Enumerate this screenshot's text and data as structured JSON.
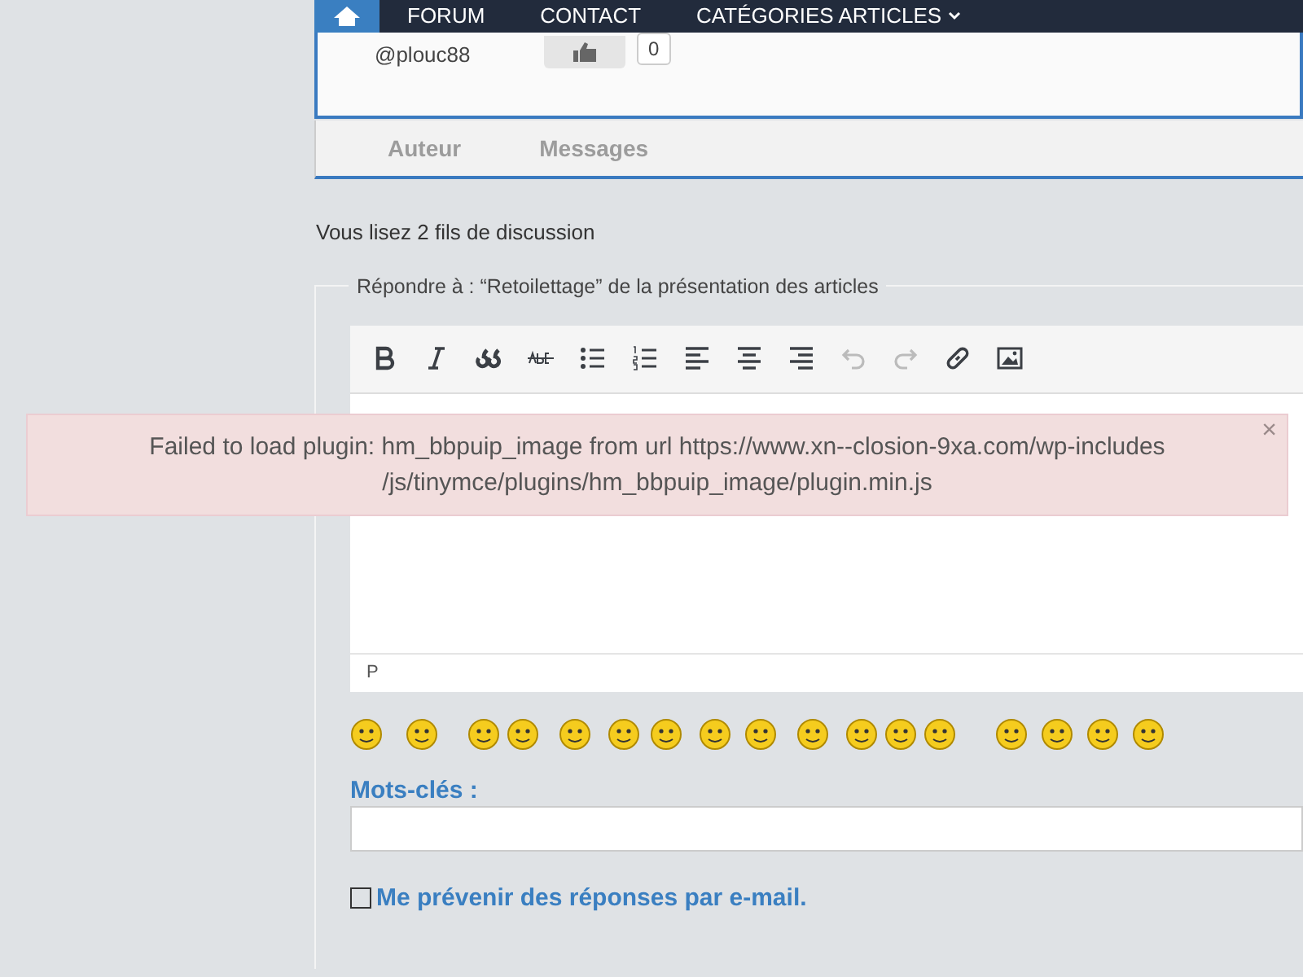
{
  "nav": {
    "items": [
      {
        "label": "FORUM",
        "dropdown": false
      },
      {
        "label": "CONTACT",
        "dropdown": false
      },
      {
        "label": "CATÉGORIES ARTICLES",
        "dropdown": true
      }
    ]
  },
  "post": {
    "author": "@plouc88",
    "likes": "0"
  },
  "table": {
    "columns": [
      "Auteur",
      "Messages"
    ]
  },
  "thread_count": "Vous lisez 2 fils de discussion",
  "reply_form": {
    "legend": "Répondre à : “Retoilettage” de la présentation des articles",
    "toolbar": [
      {
        "kind": "bold",
        "disabled": false
      },
      {
        "kind": "italic",
        "disabled": false
      },
      {
        "kind": "quote",
        "disabled": false
      },
      {
        "kind": "strike",
        "disabled": false
      },
      {
        "kind": "bullets",
        "disabled": false
      },
      {
        "kind": "numbers",
        "disabled": false
      },
      {
        "kind": "align-left",
        "disabled": false
      },
      {
        "kind": "align-center",
        "disabled": false
      },
      {
        "kind": "align-right",
        "disabled": false
      },
      {
        "kind": "undo",
        "disabled": true
      },
      {
        "kind": "redo",
        "disabled": true
      },
      {
        "kind": "link",
        "disabled": false
      },
      {
        "kind": "image",
        "disabled": false
      }
    ],
    "path": "P",
    "error": {
      "message": "Failed to load plugin: hm_bbpuip_image from url https://www.xn--closion-9xa.com/wp-includes /js/tinymce/plugins/hm_bbpuip_image/plugin.min.js",
      "close": "×"
    },
    "keywords": {
      "label": "Mots-clés :"
    },
    "notify": {
      "label": "Me prévenir des réponses par e-mail.",
      "checked": false
    }
  }
}
